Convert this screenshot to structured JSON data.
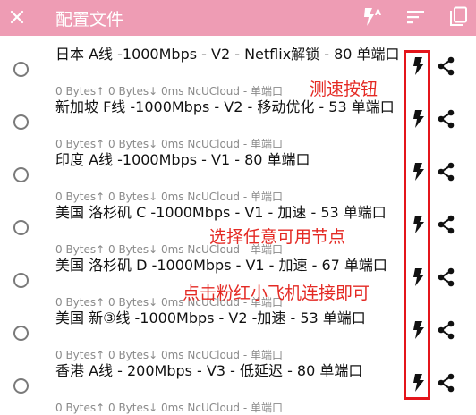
{
  "app": {
    "title": "配置文件",
    "accent": "#ee9cb4"
  },
  "toolbar": {
    "close_icon": "close-icon",
    "test_all_icon": "flash-auto-icon",
    "sort_icon": "sort-icon",
    "copy_icon": "copy-icon"
  },
  "items": [
    {
      "name": "日本 A线 -1000Mbps - V2 - Netflix解锁 - 80 单端口",
      "sub": "0 Bytes↑  0 Bytes↓  0ms NcUCloud - 单端口"
    },
    {
      "name": "新加坡 F线 -1000Mbps - V2 - 移动优化 - 53 单端口",
      "sub": "0 Bytes↑  0 Bytes↓  0ms NcUCloud - 单端口"
    },
    {
      "name": "印度 A线 -1000Mbps - V1 - 80 单端口",
      "sub": "0 Bytes↑  0 Bytes↓  0ms NcUCloud - 单端口"
    },
    {
      "name": "美国 洛杉矶 C -1000Mbps - V1 - 加速 - 53 单端口",
      "sub": "0 Bytes↑  0 Bytes↓  0ms NcUCloud - 单端口"
    },
    {
      "name": "美国 洛杉矶 D -1000Mbps - V1 - 加速 - 67 单端口",
      "sub": "0 Bytes↑  0 Bytes↓  0ms NcUCloud - 单端口"
    },
    {
      "name": "美国 新③线 -1000Mbps - V2 -加速 - 53 单端口",
      "sub": "0 Bytes↑  0 Bytes↓  0ms NcUCloud - 单端口"
    },
    {
      "name": "香港 A线 - 200Mbps - V3 - 低延迟 - 80 单端口",
      "sub": "0 Bytes↑  0 Bytes↓  0ms NcUCloud - 单端口"
    }
  ],
  "annotations": {
    "speed_test": "测速按钮",
    "choose_node": "选择任意可用节点",
    "click_plane": "点击粉红小飞机连接即可",
    "color": "#e42a24"
  }
}
